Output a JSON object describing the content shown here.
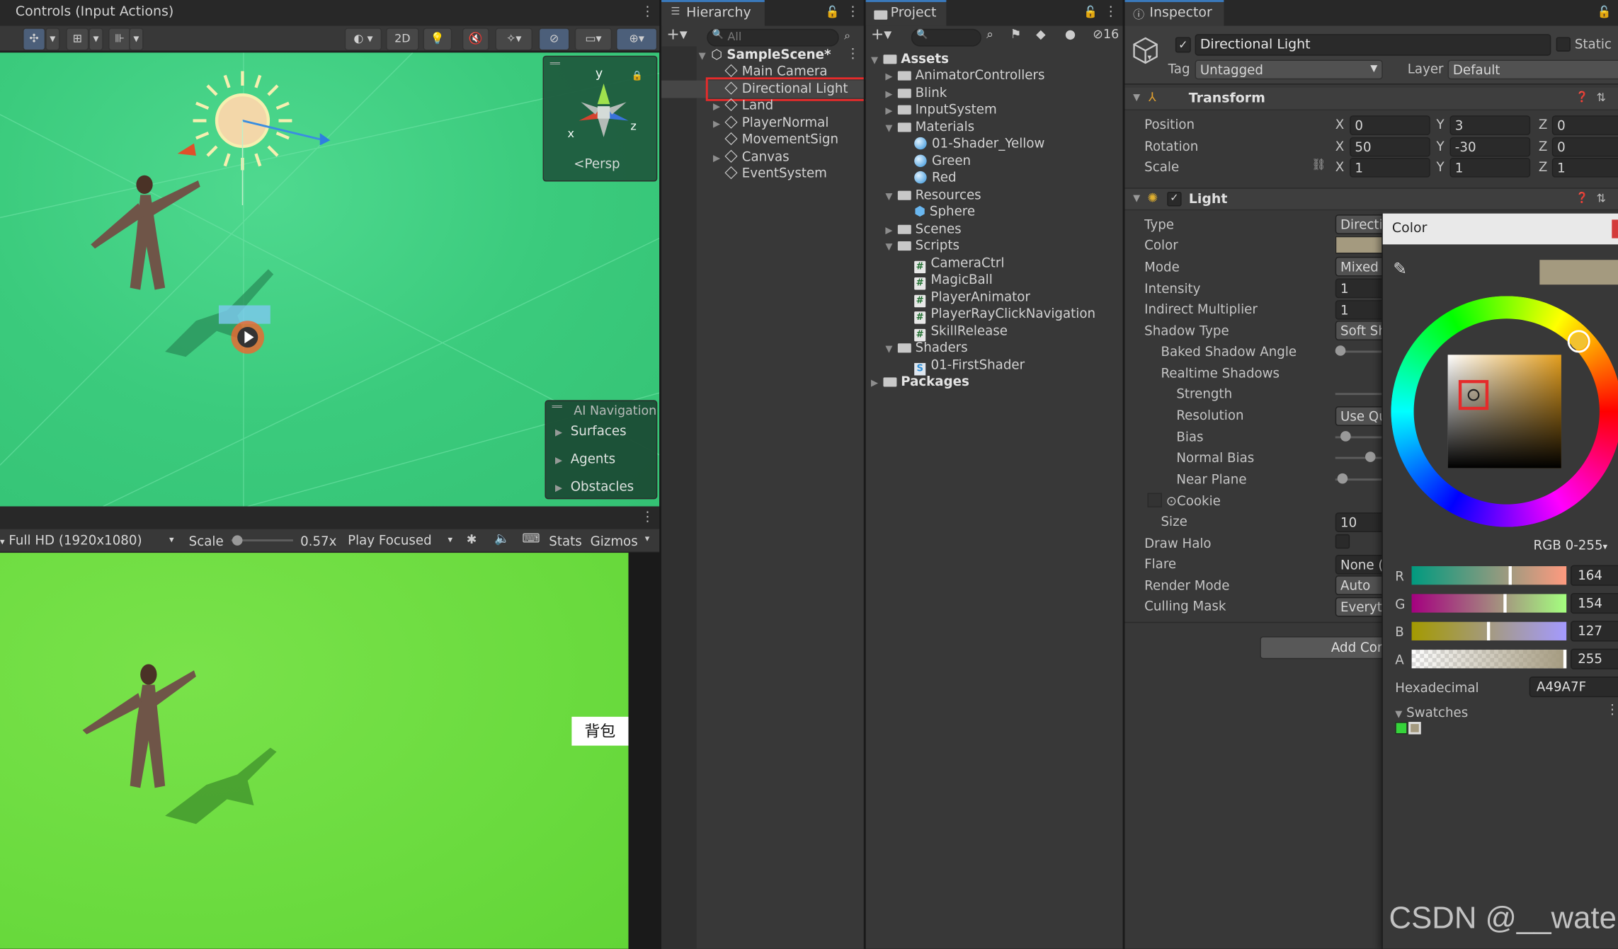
{
  "scene_view": {
    "title": "Controls (Input Actions)",
    "btn_2d": "2D",
    "gizmo_y": "y",
    "gizmo_x": "x",
    "gizmo_z": "z",
    "persp": "Persp",
    "ai_nav": {
      "title": "AI Navigation",
      "items": [
        "Surfaces",
        "Agents",
        "Obstacles"
      ]
    }
  },
  "game_view": {
    "resolution": "Full HD (1920x1080)",
    "scale_label": "Scale",
    "scale_value": "0.57x",
    "play_mode": "Play Focused",
    "stats": "Stats",
    "gizmos": "Gizmos",
    "backpack_button": "背包"
  },
  "hierarchy": {
    "title": "Hierarchy",
    "search_placeholder": "All",
    "scene": "SampleScene*",
    "items": [
      "Main Camera",
      "Directional Light",
      "Land",
      "PlayerNormal",
      "MovementSign",
      "Canvas",
      "EventSystem"
    ]
  },
  "project": {
    "title": "Project",
    "hidden_count": "16",
    "root": "Assets",
    "animator_controllers": "AnimatorControllers",
    "blink": "Blink",
    "input_system": "InputSystem",
    "materials": "Materials",
    "material_items": [
      "01-Shader_Yellow",
      "Green",
      "Red"
    ],
    "resources": "Resources",
    "sphere": "Sphere",
    "scenes": "Scenes",
    "scripts": "Scripts",
    "script_items": [
      "CameraCtrl",
      "MagicBall",
      "PlayerAnimator",
      "PlayerRayClickNavigation",
      "SkillRelease"
    ],
    "shaders": "Shaders",
    "shader_items": [
      "01-FirstShader"
    ],
    "packages": "Packages"
  },
  "inspector": {
    "title": "Inspector",
    "object_name": "Directional Light",
    "static_label": "Static",
    "tag_label": "Tag",
    "tag_value": "Untagged",
    "layer_label": "Layer",
    "layer_value": "Default",
    "transform": {
      "title": "Transform",
      "position_label": "Position",
      "rotation_label": "Rotation",
      "scale_label": "Scale",
      "position": {
        "x": "0",
        "y": "3",
        "z": "0"
      },
      "rotation": {
        "x": "50",
        "y": "-30",
        "z": "0"
      },
      "scale": {
        "x": "1",
        "y": "1",
        "z": "1"
      }
    },
    "light": {
      "title": "Light",
      "labels": {
        "type": "Type",
        "color": "Color",
        "mode": "Mode",
        "intensity": "Intensity",
        "indirect": "Indirect Multiplier",
        "shadow_type": "Shadow Type",
        "baked_angle": "Baked Shadow Angle",
        "realtime": "Realtime Shadows",
        "strength": "Strength",
        "resolution": "Resolution",
        "bias": "Bias",
        "normal_bias": "Normal Bias",
        "near_plane": "Near Plane",
        "cookie": "Cookie",
        "size": "Size",
        "draw_halo": "Draw Halo",
        "flare": "Flare",
        "render_mode": "Render Mode",
        "culling_mask": "Culling Mask"
      },
      "values": {
        "type": "Directi",
        "mode": "Mixed",
        "intensity": "1",
        "indirect": "1",
        "shadow_type": "Soft Sh",
        "resolution": "Use Qu",
        "size": "10",
        "flare": "None (I",
        "render_mode": "Auto",
        "culling_mask": "Everyth"
      },
      "add_component": "Add Con"
    }
  },
  "color_picker": {
    "title": "Color",
    "mode": "RGB 0-255",
    "channels": [
      {
        "label": "R",
        "value": "164"
      },
      {
        "label": "G",
        "value": "154"
      },
      {
        "label": "B",
        "value": "127"
      },
      {
        "label": "A",
        "value": "255"
      }
    ],
    "hex_label": "Hexadecimal",
    "hex_value": "A49A7F",
    "swatches_label": "Swatches",
    "color_hex": "#A49A7F"
  },
  "watermark": "CSDN @__water"
}
